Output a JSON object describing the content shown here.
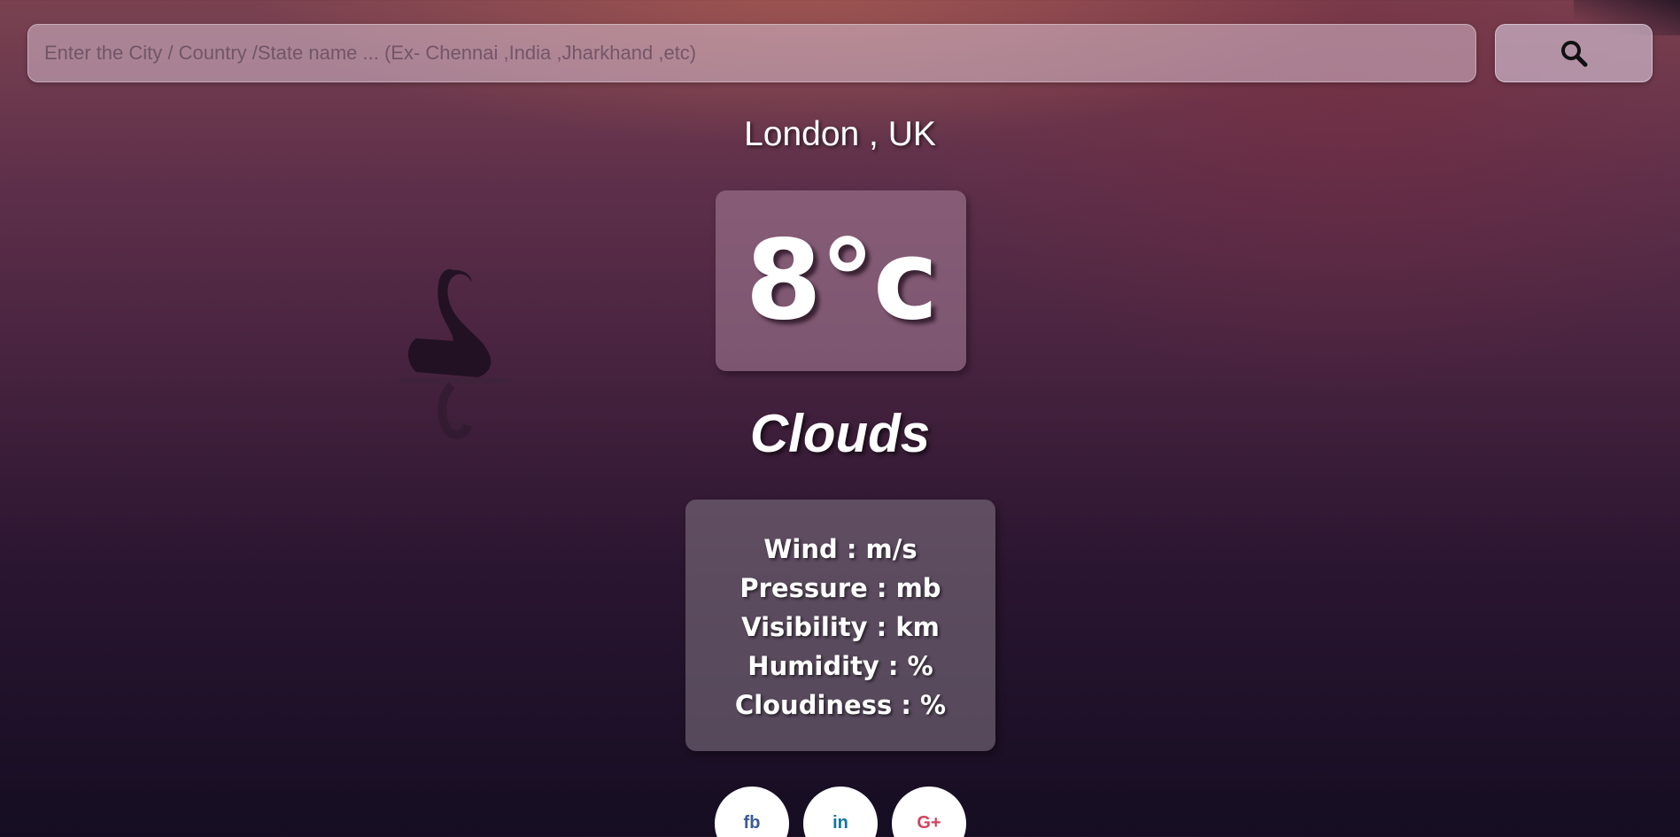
{
  "search": {
    "placeholder": "Enter the City / Country /State name ... (Ex- Chennai ,India ,Jharkhand ,etc)",
    "value": "",
    "button_icon": "search-icon"
  },
  "weather": {
    "location": "London , UK",
    "temperature": "8°c",
    "condition": "Clouds",
    "details": [
      "Wind : m/s",
      "Pressure : mb",
      "Visibility : km",
      "Humidity : %",
      "Cloudiness : %"
    ]
  },
  "social": {
    "facebook": "fb",
    "linkedin": "in",
    "googleplus": "G+"
  },
  "colors": {
    "facebook": "#3b5998",
    "linkedin": "#0e76a8",
    "googleplus": "#d1445c"
  }
}
